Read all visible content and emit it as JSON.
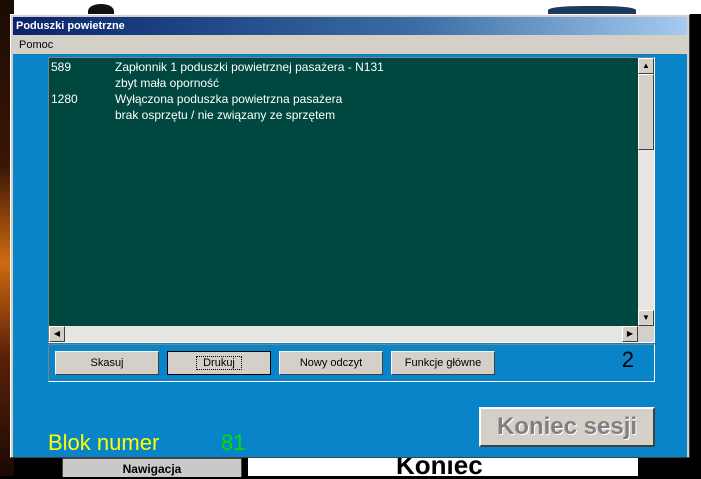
{
  "window": {
    "title": "Poduszki powietrzne"
  },
  "menu": {
    "help": "Pomoc"
  },
  "faults": [
    {
      "code": "589",
      "lines": [
        "Zapłonnik 1 poduszki powietrznej pasażera - N131",
        "zbyt mała oporność"
      ]
    },
    {
      "code": "1280",
      "lines": [
        "Wyłączona poduszka powietrzna pasażera",
        "brak osprzętu / nie związany ze sprzętem"
      ]
    }
  ],
  "buttons": {
    "clear": "Skasuj",
    "print": "Drukuj",
    "new_read": "Nowy odczyt",
    "main_functions": "Funkcje główne",
    "end_session": "Koniec sesji"
  },
  "fault_count": "2",
  "block": {
    "label": "Blok numer",
    "value": "81"
  },
  "background": {
    "nav_label": "Nawigacja",
    "partial_text": "Koniec"
  },
  "colors": {
    "list_bg": "#00483f",
    "client_bg": "#0a84c8",
    "block_label": "#ffff00",
    "block_value": "#00e000"
  }
}
